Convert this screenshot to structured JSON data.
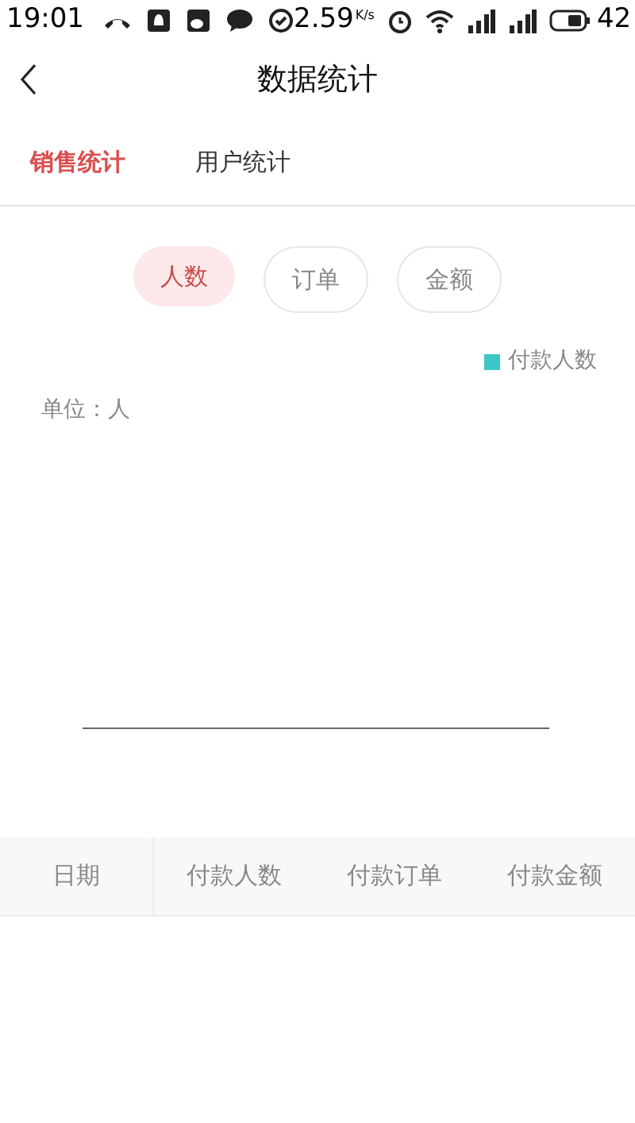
{
  "status_bar": {
    "time": "19:01",
    "speed": "2.59",
    "speed_unit": "K/s",
    "battery": "42"
  },
  "header": {
    "title": "数据统计"
  },
  "tabs": [
    {
      "label": "销售统计",
      "selected": true
    },
    {
      "label": "用户统计",
      "selected": false
    }
  ],
  "filters": [
    {
      "label": "人数",
      "selected": true
    },
    {
      "label": "订单",
      "selected": false
    },
    {
      "label": "金额",
      "selected": false
    }
  ],
  "chart": {
    "legend": [
      {
        "label": "付款人数",
        "color": "#3cc8c8"
      }
    ],
    "unit": "单位：人"
  },
  "table": {
    "columns": [
      "日期",
      "付款人数",
      "付款订单",
      "付款金额"
    ]
  }
}
